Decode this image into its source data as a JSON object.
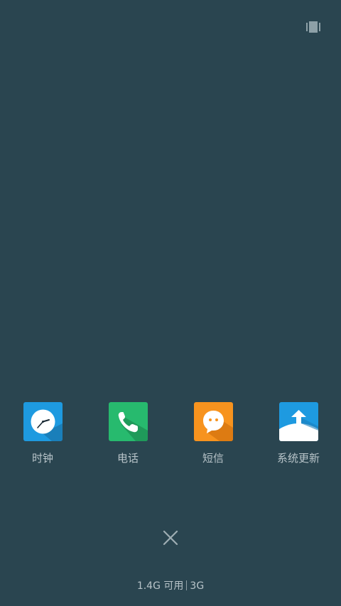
{
  "top_icon": "recent-view-toggle-icon",
  "apps": [
    {
      "label": "时钟",
      "icon": "clock-icon",
      "color": "#1e9ae0"
    },
    {
      "label": "电话",
      "icon": "phone-icon",
      "color": "#27ba6e"
    },
    {
      "label": "短信",
      "icon": "message-icon",
      "color": "#f7931e"
    },
    {
      "label": "系统更新",
      "icon": "system-update-icon",
      "color": "#1e9ae0"
    }
  ],
  "close_icon": "close-icon",
  "memory": {
    "available": "1.4G 可用",
    "total": "3G"
  }
}
